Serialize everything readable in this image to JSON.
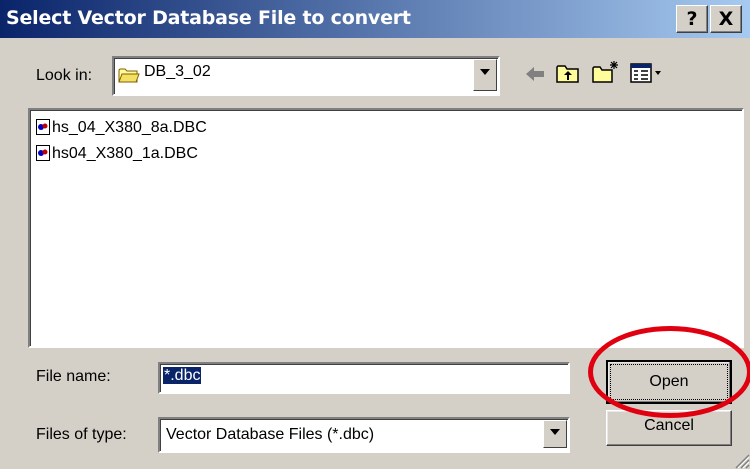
{
  "dialog": {
    "title": "Select Vector Database File to convert",
    "help_label": "?",
    "close_label": "X"
  },
  "look_in": {
    "label": "Look in:",
    "value": "DB_3_02"
  },
  "toolbar": {
    "icons": [
      "back-arrow-icon",
      "up-one-level-icon",
      "create-new-folder-icon",
      "view-menu-icon"
    ]
  },
  "files": [
    {
      "name": "hs_04_X380_8a.DBC",
      "icon": "dbc-file-icon"
    },
    {
      "name": "hs04_X380_1a.DBC",
      "icon": "dbc-file-icon"
    }
  ],
  "file_name": {
    "label": "File name:",
    "value": "*.dbc"
  },
  "file_type": {
    "label": "Files of type:",
    "value": "Vector Database Files (*.dbc)"
  },
  "buttons": {
    "open_label": "Open",
    "cancel_label": "Cancel"
  },
  "annotation": {
    "color": "#e1000f",
    "target": "open-button"
  },
  "colors": {
    "title_bar_start": "#0a246a",
    "title_bar_end": "#a6caf0",
    "face": "#d4d0c8"
  }
}
